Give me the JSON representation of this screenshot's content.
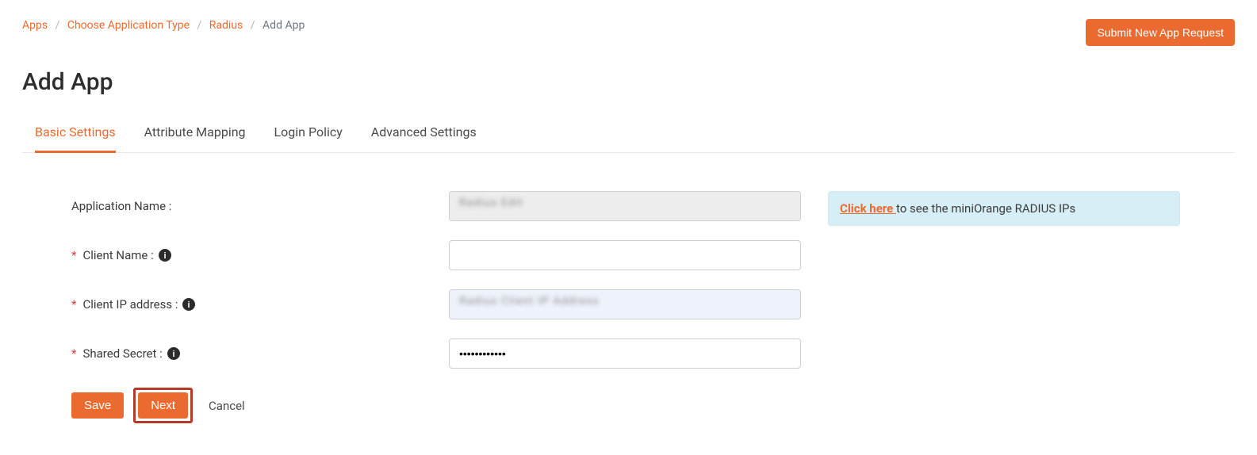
{
  "breadcrumb": {
    "apps": "Apps",
    "choose_type": "Choose Application Type",
    "radius": "Radius",
    "current": "Add App"
  },
  "header": {
    "submit_request": "Submit New App Request",
    "page_title": "Add App"
  },
  "tabs": {
    "basic": "Basic Settings",
    "attribute": "Attribute Mapping",
    "login": "Login Policy",
    "advanced": "Advanced Settings"
  },
  "form": {
    "app_name_label": "Application Name :",
    "app_name_value": "Radius   Edit",
    "client_name_label": "Client Name :",
    "client_name_value": "",
    "client_ip_label": "Client IP address :",
    "client_ip_value": "Radius Client IP Address",
    "shared_secret_label": "Shared Secret :",
    "shared_secret_value": "••••••••••••"
  },
  "info_box": {
    "link": "Click here ",
    "text": "to see the miniOrange RADIUS IPs"
  },
  "buttons": {
    "save": "Save",
    "next": "Next",
    "cancel": "Cancel"
  }
}
